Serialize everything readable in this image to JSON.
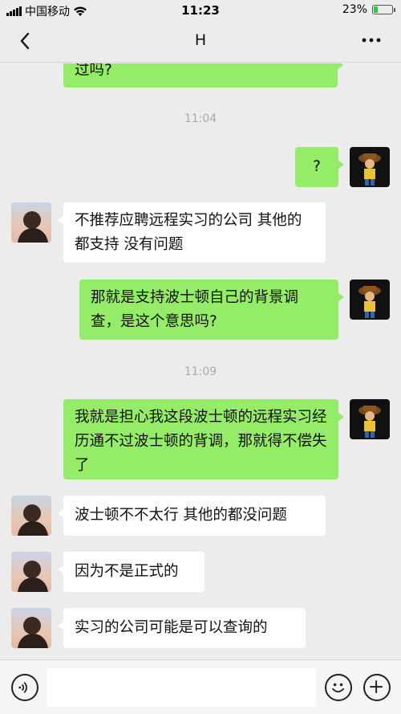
{
  "status_bar": {
    "carrier": "中国移动",
    "time": "11:23",
    "battery_percent_text": "23%",
    "battery_level": 0.23
  },
  "header": {
    "title": "H"
  },
  "messages": [
    {
      "type": "text",
      "side": "self",
      "text": "过吗?"
    },
    {
      "type": "timestamp",
      "text": "11:04"
    },
    {
      "type": "text",
      "side": "self",
      "text": "?"
    },
    {
      "type": "text",
      "side": "other",
      "text": "不推荐应聘远程实习的公司 其他的都支持 没有问题"
    },
    {
      "type": "text",
      "side": "self",
      "text": "那就是支持波士顿自己的背景调查，是这个意思吗?"
    },
    {
      "type": "timestamp",
      "text": "11:09"
    },
    {
      "type": "text",
      "side": "self",
      "text": "我就是担心我这段波士顿的远程实习经历通不过波士顿的背调，那就得不偿失了"
    },
    {
      "type": "text",
      "side": "other",
      "text": "波士顿不不太行 其他的都没问题"
    },
    {
      "type": "text",
      "side": "other",
      "text": "因为不是正式的"
    },
    {
      "type": "text",
      "side": "other",
      "text": "实习的公司可能是可以查询的"
    }
  ],
  "input": {
    "value": "",
    "placeholder": ""
  },
  "colors": {
    "self_bubble": "#95ec69",
    "other_bubble": "#ffffff",
    "background": "#ececec"
  },
  "icons": {
    "back": "chevron-left-icon",
    "more": "more-dots-icon",
    "voice": "voice-icon",
    "emoji": "emoji-icon",
    "plus": "plus-icon"
  }
}
